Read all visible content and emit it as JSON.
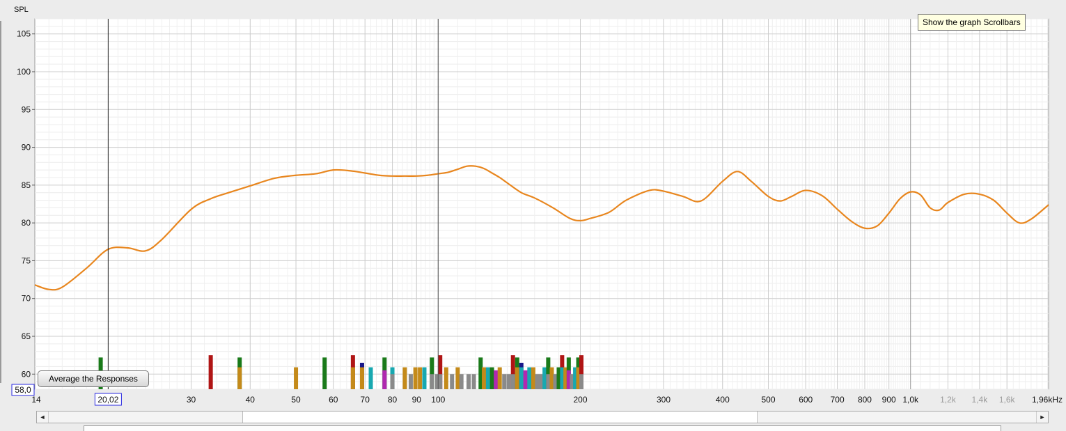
{
  "chart_data": {
    "type": "line",
    "ylabel": "SPL",
    "xunit": "Hz",
    "x_scale": "log",
    "xlim": [
      14,
      1960
    ],
    "ylim": [
      58,
      107
    ],
    "grid": true,
    "yticks": [
      60,
      65,
      70,
      75,
      80,
      85,
      90,
      95,
      100,
      105
    ],
    "xticks": [
      {
        "value": 14,
        "label": "14"
      },
      {
        "value": 30,
        "label": "30"
      },
      {
        "value": 40,
        "label": "40"
      },
      {
        "value": 50,
        "label": "50"
      },
      {
        "value": 60,
        "label": "60"
      },
      {
        "value": 70,
        "label": "70"
      },
      {
        "value": 80,
        "label": "80"
      },
      {
        "value": 90,
        "label": "90"
      },
      {
        "value": 100,
        "label": "100"
      },
      {
        "value": 200,
        "label": "200"
      },
      {
        "value": 300,
        "label": "300"
      },
      {
        "value": 400,
        "label": "400"
      },
      {
        "value": 500,
        "label": "500"
      },
      {
        "value": 600,
        "label": "600"
      },
      {
        "value": 700,
        "label": "700"
      },
      {
        "value": 800,
        "label": "800"
      },
      {
        "value": 900,
        "label": "900"
      },
      {
        "value": 1000,
        "label": "1,0k"
      },
      {
        "value": 1200,
        "label": "1,2k",
        "dim": true
      },
      {
        "value": 1400,
        "label": "1,4k",
        "dim": true
      },
      {
        "value": 1600,
        "label": "1,6k",
        "dim": true
      },
      {
        "value": 1960,
        "label": "1,96kHz"
      }
    ],
    "series": [
      {
        "color": "#e8861e",
        "x": [
          14,
          15,
          16,
          18,
          20,
          22,
          24,
          26,
          30,
          33,
          36,
          40,
          45,
          50,
          55,
          60,
          65,
          70,
          75,
          80,
          85,
          90,
          95,
          100,
          105,
          110,
          115,
          120,
          125,
          130,
          135,
          140,
          150,
          160,
          175,
          190,
          200,
          210,
          230,
          250,
          280,
          300,
          330,
          360,
          400,
          430,
          460,
          500,
          530,
          560,
          600,
          650,
          700,
          750,
          800,
          850,
          900,
          950,
          1000,
          1050,
          1100,
          1150,
          1200,
          1300,
          1400,
          1500,
          1600,
          1700,
          1800,
          1960
        ],
        "y": [
          71.8,
          71.2,
          71.5,
          74.0,
          76.5,
          76.7,
          76.3,
          77.8,
          81.8,
          83.2,
          84.0,
          84.9,
          85.9,
          86.3,
          86.5,
          87.0,
          86.9,
          86.6,
          86.3,
          86.2,
          86.2,
          86.2,
          86.3,
          86.5,
          86.7,
          87.1,
          87.5,
          87.5,
          87.2,
          86.6,
          86.0,
          85.3,
          84.0,
          83.3,
          82.0,
          80.6,
          80.3,
          80.6,
          81.4,
          83.0,
          84.3,
          84.2,
          83.5,
          82.9,
          85.5,
          86.8,
          85.5,
          83.5,
          82.9,
          83.5,
          84.3,
          83.6,
          81.8,
          80.2,
          79.3,
          79.6,
          81.3,
          83.2,
          84.1,
          83.7,
          82.0,
          81.7,
          82.7,
          83.8,
          83.8,
          83.0,
          81.3,
          80.0,
          80.5,
          82.4
        ]
      }
    ],
    "markers": [
      {
        "x": 20.02,
        "label": "20,02"
      },
      {
        "x": 100
      }
    ],
    "y_readout": "58,0",
    "filter_bars": [
      {
        "x": 19.3,
        "y": 62.2,
        "color": "#1a7a1a"
      },
      {
        "x": 33.0,
        "y": 62.5,
        "color": "#b01515"
      },
      {
        "x": 38.0,
        "y": 62.2,
        "color": "#1a7a1a"
      },
      {
        "x": 38.0,
        "y": 60.9,
        "color": "#c48a1a"
      },
      {
        "x": 50.0,
        "y": 60.9,
        "color": "#c48a1a"
      },
      {
        "x": 57.5,
        "y": 62.2,
        "color": "#1a7a1a"
      },
      {
        "x": 66.0,
        "y": 62.5,
        "color": "#b01515"
      },
      {
        "x": 66.0,
        "y": 60.9,
        "color": "#c48a1a"
      },
      {
        "x": 69.0,
        "y": 61.5,
        "color": "#18188a"
      },
      {
        "x": 69.0,
        "y": 60.9,
        "color": "#c48a1a"
      },
      {
        "x": 72.0,
        "y": 60.9,
        "color": "#18a8b0"
      },
      {
        "x": 77.0,
        "y": 62.2,
        "color": "#1a7a1a"
      },
      {
        "x": 77.0,
        "y": 60.5,
        "color": "#b028b0"
      },
      {
        "x": 80.0,
        "y": 60.9,
        "color": "#18a8b0"
      },
      {
        "x": 80.0,
        "y": 60.0,
        "color": "#8a8a8a"
      },
      {
        "x": 85.0,
        "y": 60.9,
        "color": "#c48a1a"
      },
      {
        "x": 87.5,
        "y": 60.0,
        "color": "#8a8a8a"
      },
      {
        "x": 89.5,
        "y": 60.9,
        "color": "#c48a1a"
      },
      {
        "x": 91.5,
        "y": 60.9,
        "color": "#c48a1a"
      },
      {
        "x": 93.5,
        "y": 60.9,
        "color": "#18a8b0"
      },
      {
        "x": 97.0,
        "y": 62.2,
        "color": "#1a7a1a"
      },
      {
        "x": 97.0,
        "y": 60.0,
        "color": "#8a8a8a"
      },
      {
        "x": 99.5,
        "y": 60.0,
        "color": "#8a8a8a"
      },
      {
        "x": 101.0,
        "y": 62.5,
        "color": "#b01515"
      },
      {
        "x": 101.0,
        "y": 60.0,
        "color": "#8a8a8a"
      },
      {
        "x": 104.0,
        "y": 60.9,
        "color": "#c48a1a"
      },
      {
        "x": 107.0,
        "y": 60.0,
        "color": "#8a8a8a"
      },
      {
        "x": 110.0,
        "y": 60.9,
        "color": "#c48a1a"
      },
      {
        "x": 112.0,
        "y": 60.0,
        "color": "#8a8a8a"
      },
      {
        "x": 116.0,
        "y": 60.0,
        "color": "#8a8a8a"
      },
      {
        "x": 119.0,
        "y": 60.0,
        "color": "#8a8a8a"
      },
      {
        "x": 123.0,
        "y": 62.2,
        "color": "#1a7a1a"
      },
      {
        "x": 125.0,
        "y": 60.9,
        "color": "#c48a1a"
      },
      {
        "x": 127.5,
        "y": 60.9,
        "color": "#18a8b0"
      },
      {
        "x": 130.0,
        "y": 60.9,
        "color": "#1a7a1a"
      },
      {
        "x": 132.5,
        "y": 60.5,
        "color": "#b028b0"
      },
      {
        "x": 135.0,
        "y": 60.9,
        "color": "#c48a1a"
      },
      {
        "x": 138.0,
        "y": 60.0,
        "color": "#8a8a8a"
      },
      {
        "x": 141.0,
        "y": 60.0,
        "color": "#8a8a8a"
      },
      {
        "x": 144.0,
        "y": 62.5,
        "color": "#b01515"
      },
      {
        "x": 144.0,
        "y": 60.0,
        "color": "#8a8a8a"
      },
      {
        "x": 147.0,
        "y": 62.2,
        "color": "#1a7a1a"
      },
      {
        "x": 147.0,
        "y": 60.9,
        "color": "#c48a1a"
      },
      {
        "x": 150.0,
        "y": 61.5,
        "color": "#18188a"
      },
      {
        "x": 150.0,
        "y": 60.9,
        "color": "#18a8b0"
      },
      {
        "x": 153.0,
        "y": 60.5,
        "color": "#b028b0"
      },
      {
        "x": 156.0,
        "y": 60.9,
        "color": "#18a8b0"
      },
      {
        "x": 159.0,
        "y": 60.9,
        "color": "#c48a1a"
      },
      {
        "x": 162.0,
        "y": 60.0,
        "color": "#8a8a8a"
      },
      {
        "x": 165.0,
        "y": 60.0,
        "color": "#8a8a8a"
      },
      {
        "x": 168.0,
        "y": 60.9,
        "color": "#18a8b0"
      },
      {
        "x": 171.0,
        "y": 62.2,
        "color": "#1a7a1a"
      },
      {
        "x": 171.0,
        "y": 60.0,
        "color": "#8a8a8a"
      },
      {
        "x": 174.0,
        "y": 60.9,
        "color": "#c48a1a"
      },
      {
        "x": 177.0,
        "y": 60.0,
        "color": "#8a8a8a"
      },
      {
        "x": 180.0,
        "y": 60.9,
        "color": "#1a7a1a"
      },
      {
        "x": 183.0,
        "y": 62.5,
        "color": "#b01515"
      },
      {
        "x": 183.0,
        "y": 60.9,
        "color": "#18a8b0"
      },
      {
        "x": 186.0,
        "y": 60.9,
        "color": "#c48a1a"
      },
      {
        "x": 189.0,
        "y": 62.2,
        "color": "#1a7a1a"
      },
      {
        "x": 189.0,
        "y": 60.5,
        "color": "#b028b0"
      },
      {
        "x": 192.0,
        "y": 60.0,
        "color": "#8a8a8a"
      },
      {
        "x": 195.0,
        "y": 60.9,
        "color": "#18a8b0"
      },
      {
        "x": 198.0,
        "y": 62.2,
        "color": "#1a7a1a"
      },
      {
        "x": 198.0,
        "y": 60.9,
        "color": "#c48a1a"
      },
      {
        "x": 201.0,
        "y": 62.5,
        "color": "#b01515"
      },
      {
        "x": 201.0,
        "y": 60.0,
        "color": "#8a8a8a"
      }
    ]
  },
  "controls": {
    "average_button_label": "Average the Responses",
    "tooltip_text": "Show the graph Scrollbars",
    "scroll_left": "◄",
    "scroll_right": "►"
  }
}
